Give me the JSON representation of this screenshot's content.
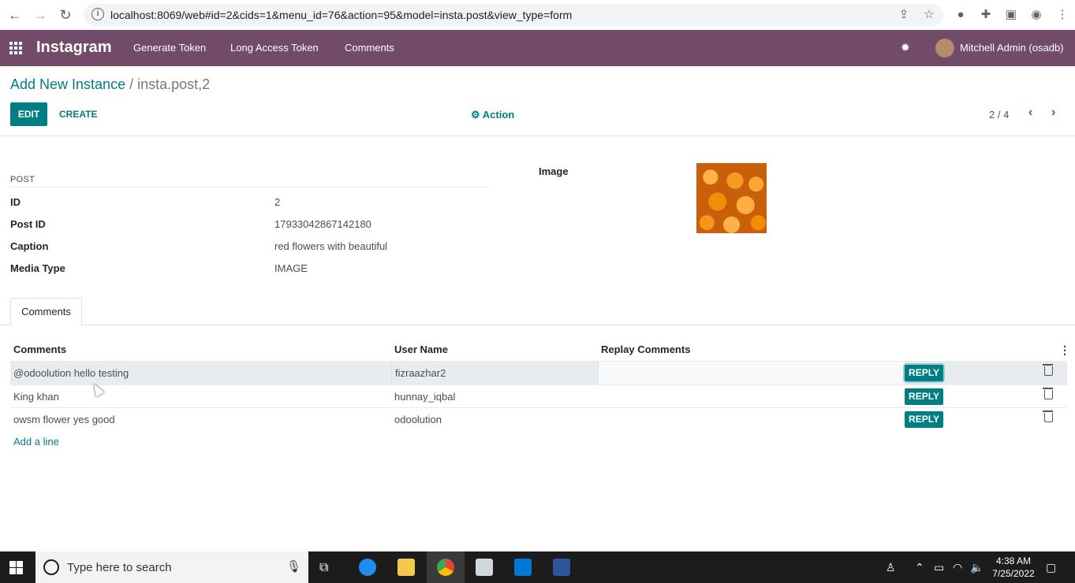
{
  "browser": {
    "url": "localhost:8069/web#id=2&cids=1&menu_id=76&action=95&model=insta.post&view_type=form"
  },
  "navbar": {
    "app_name": "Instagram",
    "menu": [
      "Generate Token",
      "Long Access Token",
      "Comments"
    ],
    "user": "Mitchell Admin (osadb)"
  },
  "control_panel": {
    "breadcrumb_parent": "Add New Instance",
    "breadcrumb_current": "/ insta.post,2",
    "edit_label": "EDIT",
    "create_label": "CREATE",
    "action_label": "Action",
    "pager": "2 / 4"
  },
  "form": {
    "section_title": "POST",
    "fields": [
      {
        "label": "ID",
        "value": "2"
      },
      {
        "label": "Post ID",
        "value": "17933042867142180"
      },
      {
        "label": "Caption",
        "value": "red flowers with beautiful"
      },
      {
        "label": "Media Type",
        "value": "IMAGE"
      }
    ],
    "image_label": "Image"
  },
  "tabs": [
    {
      "label": "Comments"
    }
  ],
  "comments_table": {
    "headers": [
      "Comments",
      "User Name",
      "Replay Comments"
    ],
    "rows": [
      {
        "comment": "@odoolution hello testing",
        "user": "fizraazhar2",
        "reply_label": "REPLY"
      },
      {
        "comment": "King khan",
        "user": "hunnay_iqbal",
        "reply_label": "REPLY"
      },
      {
        "comment": "owsm flower yes good",
        "user": "odoolution",
        "reply_label": "REPLY"
      }
    ],
    "add_line": "Add a line"
  },
  "taskbar": {
    "search_placeholder": "Type here to search",
    "time": "4:38 AM",
    "date": "7/25/2022"
  },
  "colors": {
    "navbar": "#714b67",
    "primary": "#017e84"
  }
}
